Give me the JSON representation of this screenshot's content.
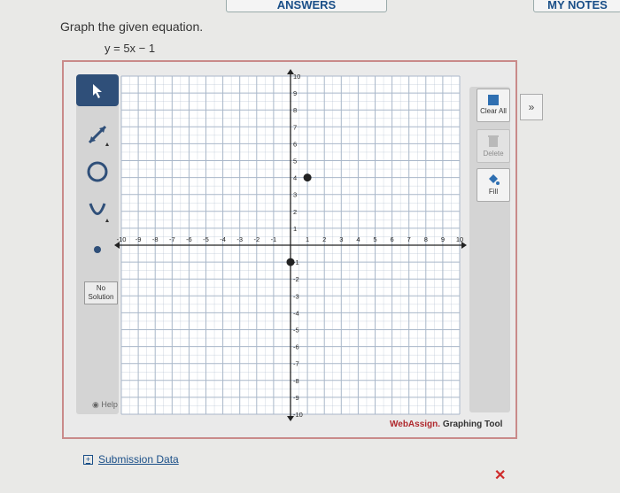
{
  "header": {
    "answers_button_label": "ANSWERS",
    "notes_button_label": "MY NOTES"
  },
  "question": {
    "prompt": "Graph the given equation.",
    "equation": "y = 5x − 1"
  },
  "tools": {
    "no_solution_label": "No Solution",
    "help_label": "Help"
  },
  "sidebar": {
    "clear_all_label": "Clear All",
    "delete_label": "Delete",
    "fill_label": "Fill",
    "expand_label": "»"
  },
  "graph": {
    "x_range": [
      -10,
      10
    ],
    "y_range": [
      -10,
      10
    ],
    "grid_step": 1,
    "x_tick_labels": [
      "-10",
      "-9",
      "-8",
      "-7",
      "-6",
      "-5",
      "-4",
      "-3",
      "-2",
      "-1",
      "1",
      "2",
      "3",
      "4",
      "5",
      "6",
      "7",
      "8",
      "9",
      "10"
    ],
    "y_tick_labels": [
      "10",
      "9",
      "8",
      "7",
      "6",
      "5",
      "4",
      "3",
      "2",
      "1",
      "-1",
      "-2",
      "-3",
      "-4",
      "-5",
      "-6",
      "-7",
      "-8",
      "-9",
      "-10"
    ],
    "plotted_points": [
      {
        "x": 1,
        "y": 4
      },
      {
        "x": 0,
        "y": -1
      }
    ],
    "point_color": "#222222",
    "grid_color": "#a9b7c9"
  },
  "footer": {
    "brand_web": "WebAssign.",
    "brand_tool": " Graphing Tool",
    "submission_label": "Submission Data",
    "submission_toggle": "+",
    "incorrect_mark": "✕"
  },
  "colors": {
    "accent": "#2f4f79",
    "panel_border": "#c98a8a",
    "link": "#1a4f88",
    "incorrect": "#cf2b2b"
  }
}
